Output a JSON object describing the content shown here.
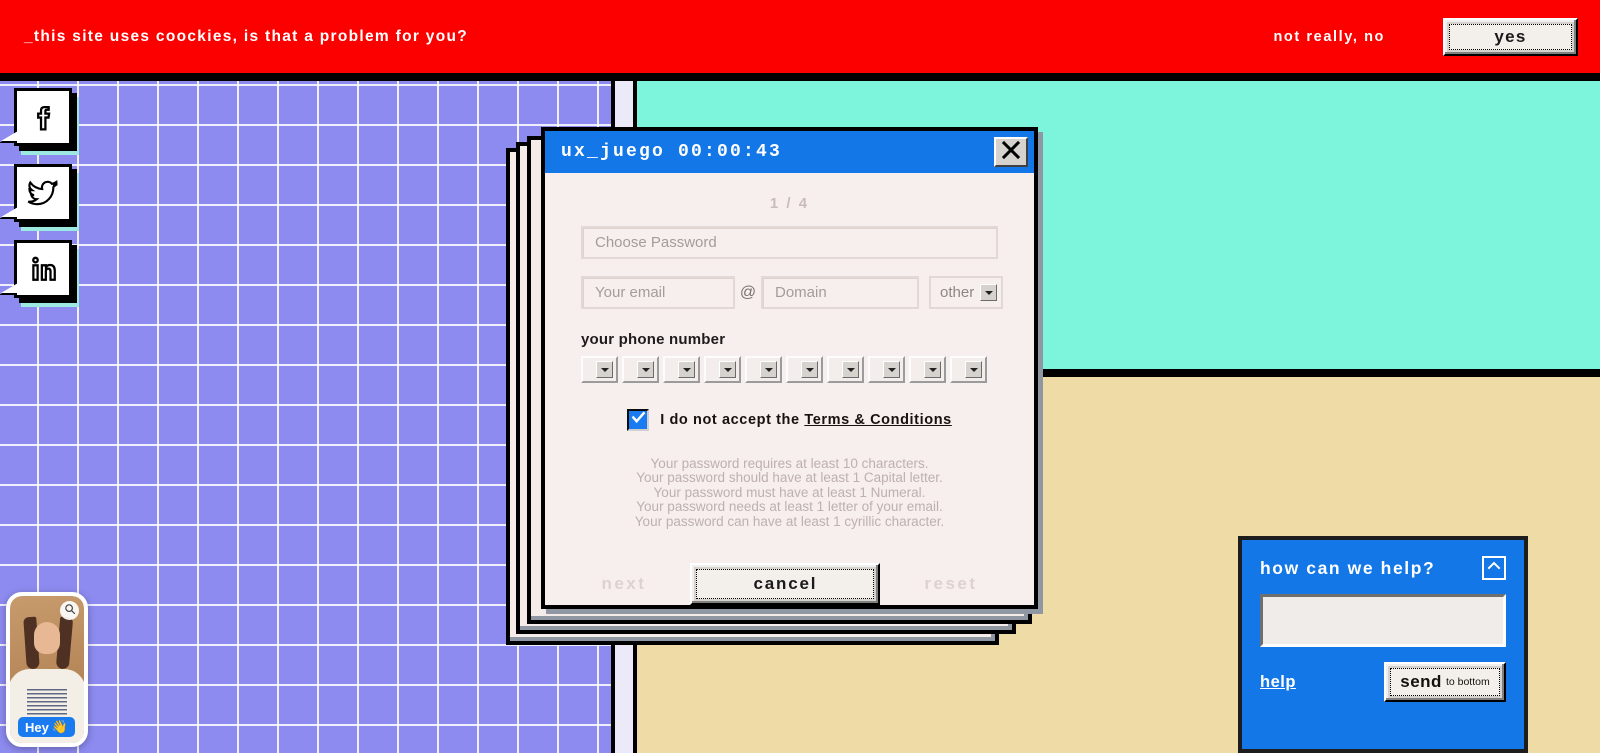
{
  "cookie_banner": {
    "message": "_this site uses coockies, is that a problem for you?",
    "decline_label": "not really, no",
    "accept_label": "yes",
    "bg_color": "#fc0000"
  },
  "social": {
    "items": [
      {
        "name": "facebook",
        "icon": "facebook-icon"
      },
      {
        "name": "twitter",
        "icon": "twitter-icon"
      },
      {
        "name": "linkedin",
        "icon": "linkedin-icon"
      }
    ]
  },
  "background": {
    "purple_color": "#8d8bf0",
    "cyan_color": "#7cf5dc",
    "tan_color": "#eedba6",
    "gutter_color": "#ece9f8"
  },
  "dialog": {
    "title": "ux_juego 00:00:43",
    "title_bar_color": "#1377e8",
    "close_icon": "close-icon",
    "page_indicator": "1 / 4",
    "password_placeholder": "Choose Password",
    "email_placeholder": "Your email",
    "at_symbol": "@",
    "domain_placeholder": "Domain",
    "domain_select_value": "other",
    "phone_label": "your phone number",
    "phone_select_count": 10,
    "terms": {
      "checkbox_checked": true,
      "text_before": "I do not accept the",
      "link_label": "Terms & Conditions"
    },
    "rules": [
      "Your password requires at least 10 characters.",
      "Your password should have at least 1 Capital letter.",
      "Your password must have at least 1 Numeral.",
      "Your password needs at least 1 letter of your email.",
      "Your password can have at least 1 cyrillic character."
    ],
    "footer": {
      "next_label": "next",
      "cancel_label": "cancel",
      "reset_label": "reset"
    }
  },
  "video_widget": {
    "badge_label": "Hey",
    "badge_emoji": "👋",
    "zoom_icon": "magnifier-icon"
  },
  "chat": {
    "title": "how can we help?",
    "collapse_icon": "chevron-up-icon",
    "message_value": "",
    "message_placeholder": "",
    "help_label": "help",
    "send_label": "send",
    "send_sublabel": "to bottom",
    "bg_color": "#1377e8"
  }
}
